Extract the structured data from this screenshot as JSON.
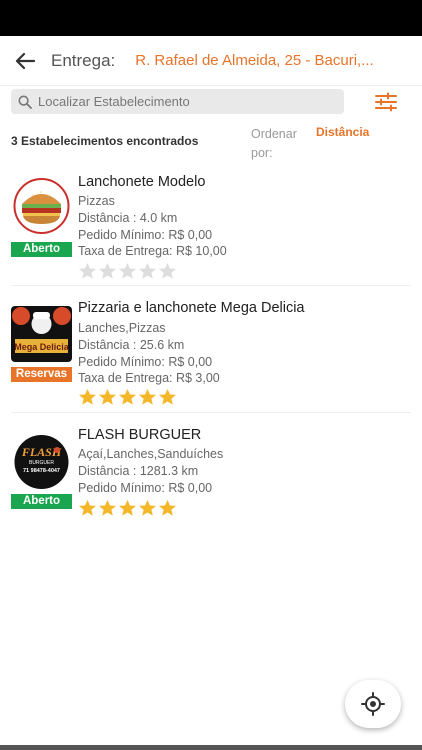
{
  "header": {
    "back_icon": "arrow-left-icon",
    "title": "Entrega:",
    "address": "R. Rafael de Almeida, 25 - Bacuri,..."
  },
  "search": {
    "placeholder": "Localizar Estabelecimento",
    "value": "",
    "icon": "search-icon",
    "filter_icon": "sliders-icon"
  },
  "results": {
    "count_text": "3 Estabelecimentos encontrados",
    "order_label": "Ordenar por:",
    "order_value": "Distância"
  },
  "colors": {
    "accent": "#e8742a",
    "open": "#1aa64f",
    "star_filled": "#f5b72a",
    "star_empty": "#dddddd"
  },
  "establishments": [
    {
      "name": "Lanchonete Modelo",
      "categories": "Pizzas",
      "distance": "Distância : 4.0 km",
      "min_order": "Pedido Mínimo: R$ 0,00",
      "delivery_fee": "Taxa de Entrega: R$ 10,00",
      "status": "Aberto",
      "rating": 0
    },
    {
      "name": "Pizzaria e lanchonete Mega Delicia",
      "categories": "Lanches,Pizzas",
      "distance": "Distância : 25.6 km",
      "min_order": "Pedido Mínimo: R$ 0,00",
      "delivery_fee": "Taxa de Entrega: R$ 3,00",
      "status": "Reservas",
      "rating": 5,
      "logo_text": "Mega Delicia"
    },
    {
      "name": "FLASH BURGUER",
      "categories": "Açaí,Lanches,Sanduíches",
      "distance": "Distância : 1281.3 km",
      "min_order": "Pedido Mínimo: R$ 0,00",
      "status": "Aberto",
      "rating": 5,
      "logo_text": "FLASH",
      "logo_sub": "BURGUER",
      "logo_phone": "71 98478-4047"
    }
  ],
  "fab": {
    "icon": "location-target-icon"
  }
}
